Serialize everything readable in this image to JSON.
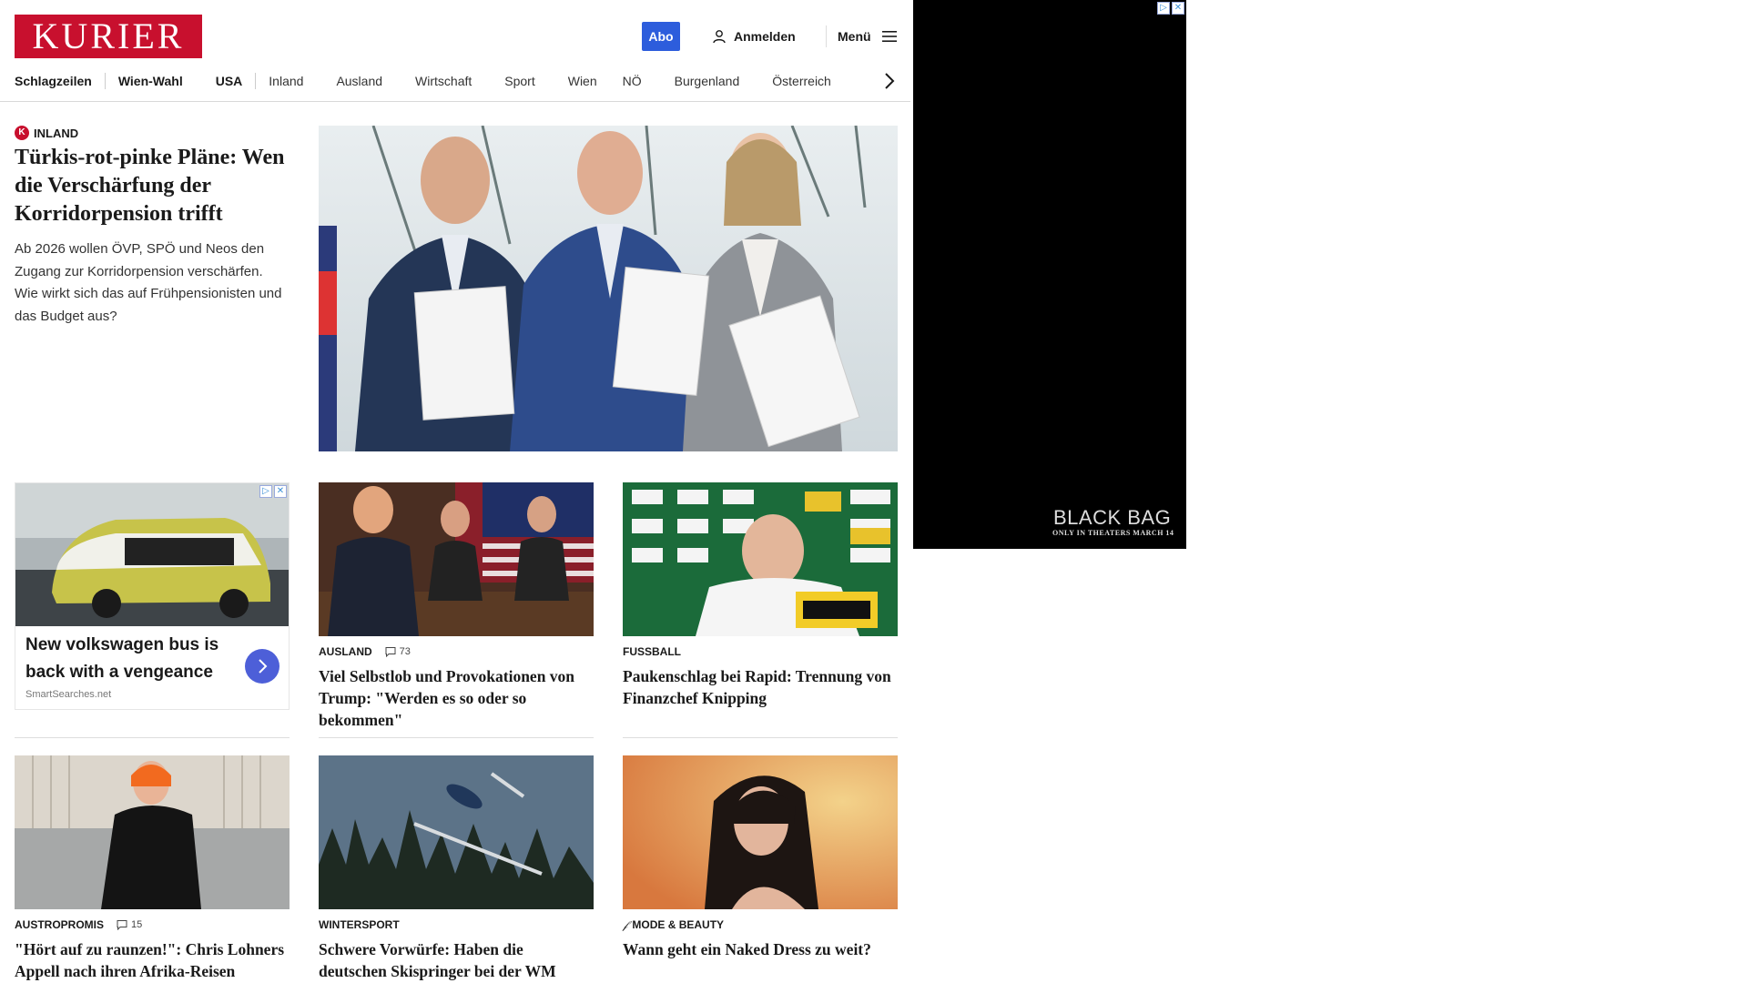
{
  "header": {
    "logo": "KURIER",
    "abo": "Abo",
    "login": "Anmelden",
    "menu": "Menü"
  },
  "nav": {
    "items": [
      "Schlagzeilen",
      "Wien-Wahl",
      "USA",
      "Inland",
      "Ausland",
      "Wirtschaft",
      "Sport",
      "Wien",
      "NÖ",
      "Burgenland",
      "Österreich"
    ]
  },
  "hero": {
    "badge": "K",
    "category": "Inland",
    "title": "Türkis-rot-pinke Pläne: Wen die Verschärfung der Korridorpension trifft",
    "teaser": "Ab 2026 wollen ÖVP, SPÖ und Neos den Zugang zur Korridorpension verschärfen. Wie wirkt sich das auf Frühpensionisten und das Budget aus?"
  },
  "ad_card": {
    "title": "New volkswagen bus is back with a vengeance",
    "source": "SmartSearches.net"
  },
  "cards": [
    {
      "category": "Ausland",
      "comments": "73",
      "title": "Viel Selbstlob und Provokationen von Trump: \"Werden es so oder so bekommen\""
    },
    {
      "category": "Fussball",
      "comments": "",
      "title": "Paukenschlag bei Rapid: Trennung von Finanzchef Knipping"
    },
    {
      "category": "Austropromis",
      "comments": "15",
      "title": "\"Hört auf zu raunzen!\": Chris Lohners Appell nach ihren Afrika-Reisen"
    },
    {
      "category": "Wintersport",
      "comments": "",
      "title": "Schwere Vorwürfe: Haben die deutschen Skispringer bei der WM geschummelt?"
    },
    {
      "category": "Mode & Beauty",
      "comments": "",
      "title": "Wann geht ein Naked Dress zu weit?"
    }
  ],
  "side_ad": {
    "brand": "BLACK BAG",
    "tagline": "ONLY IN THEATERS MARCH 14"
  },
  "colors": {
    "brand_red": "#c8102e",
    "abo_blue": "#2d5ddc",
    "ad_button": "#4d5fd8"
  }
}
